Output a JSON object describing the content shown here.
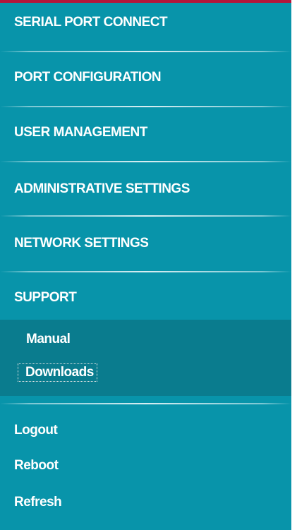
{
  "accent_colors": {
    "top_border": "#b3163a",
    "sidebar_bg": "#0894aa",
    "submenu_bg": "#0a7c8e"
  },
  "menu": [
    {
      "label": "SERIAL PORT CONNECT"
    },
    {
      "label": "PORT CONFIGURATION"
    },
    {
      "label": "USER MANAGEMENT"
    },
    {
      "label": "ADMINISTRATIVE SETTINGS"
    },
    {
      "label": "NETWORK SETTINGS"
    },
    {
      "label": "SUPPORT"
    }
  ],
  "support_submenu": [
    {
      "label": "Manual"
    },
    {
      "label": "Downloads",
      "focused": true
    }
  ],
  "utility_links": [
    {
      "label": "Logout"
    },
    {
      "label": "Reboot"
    },
    {
      "label": "Refresh"
    }
  ]
}
